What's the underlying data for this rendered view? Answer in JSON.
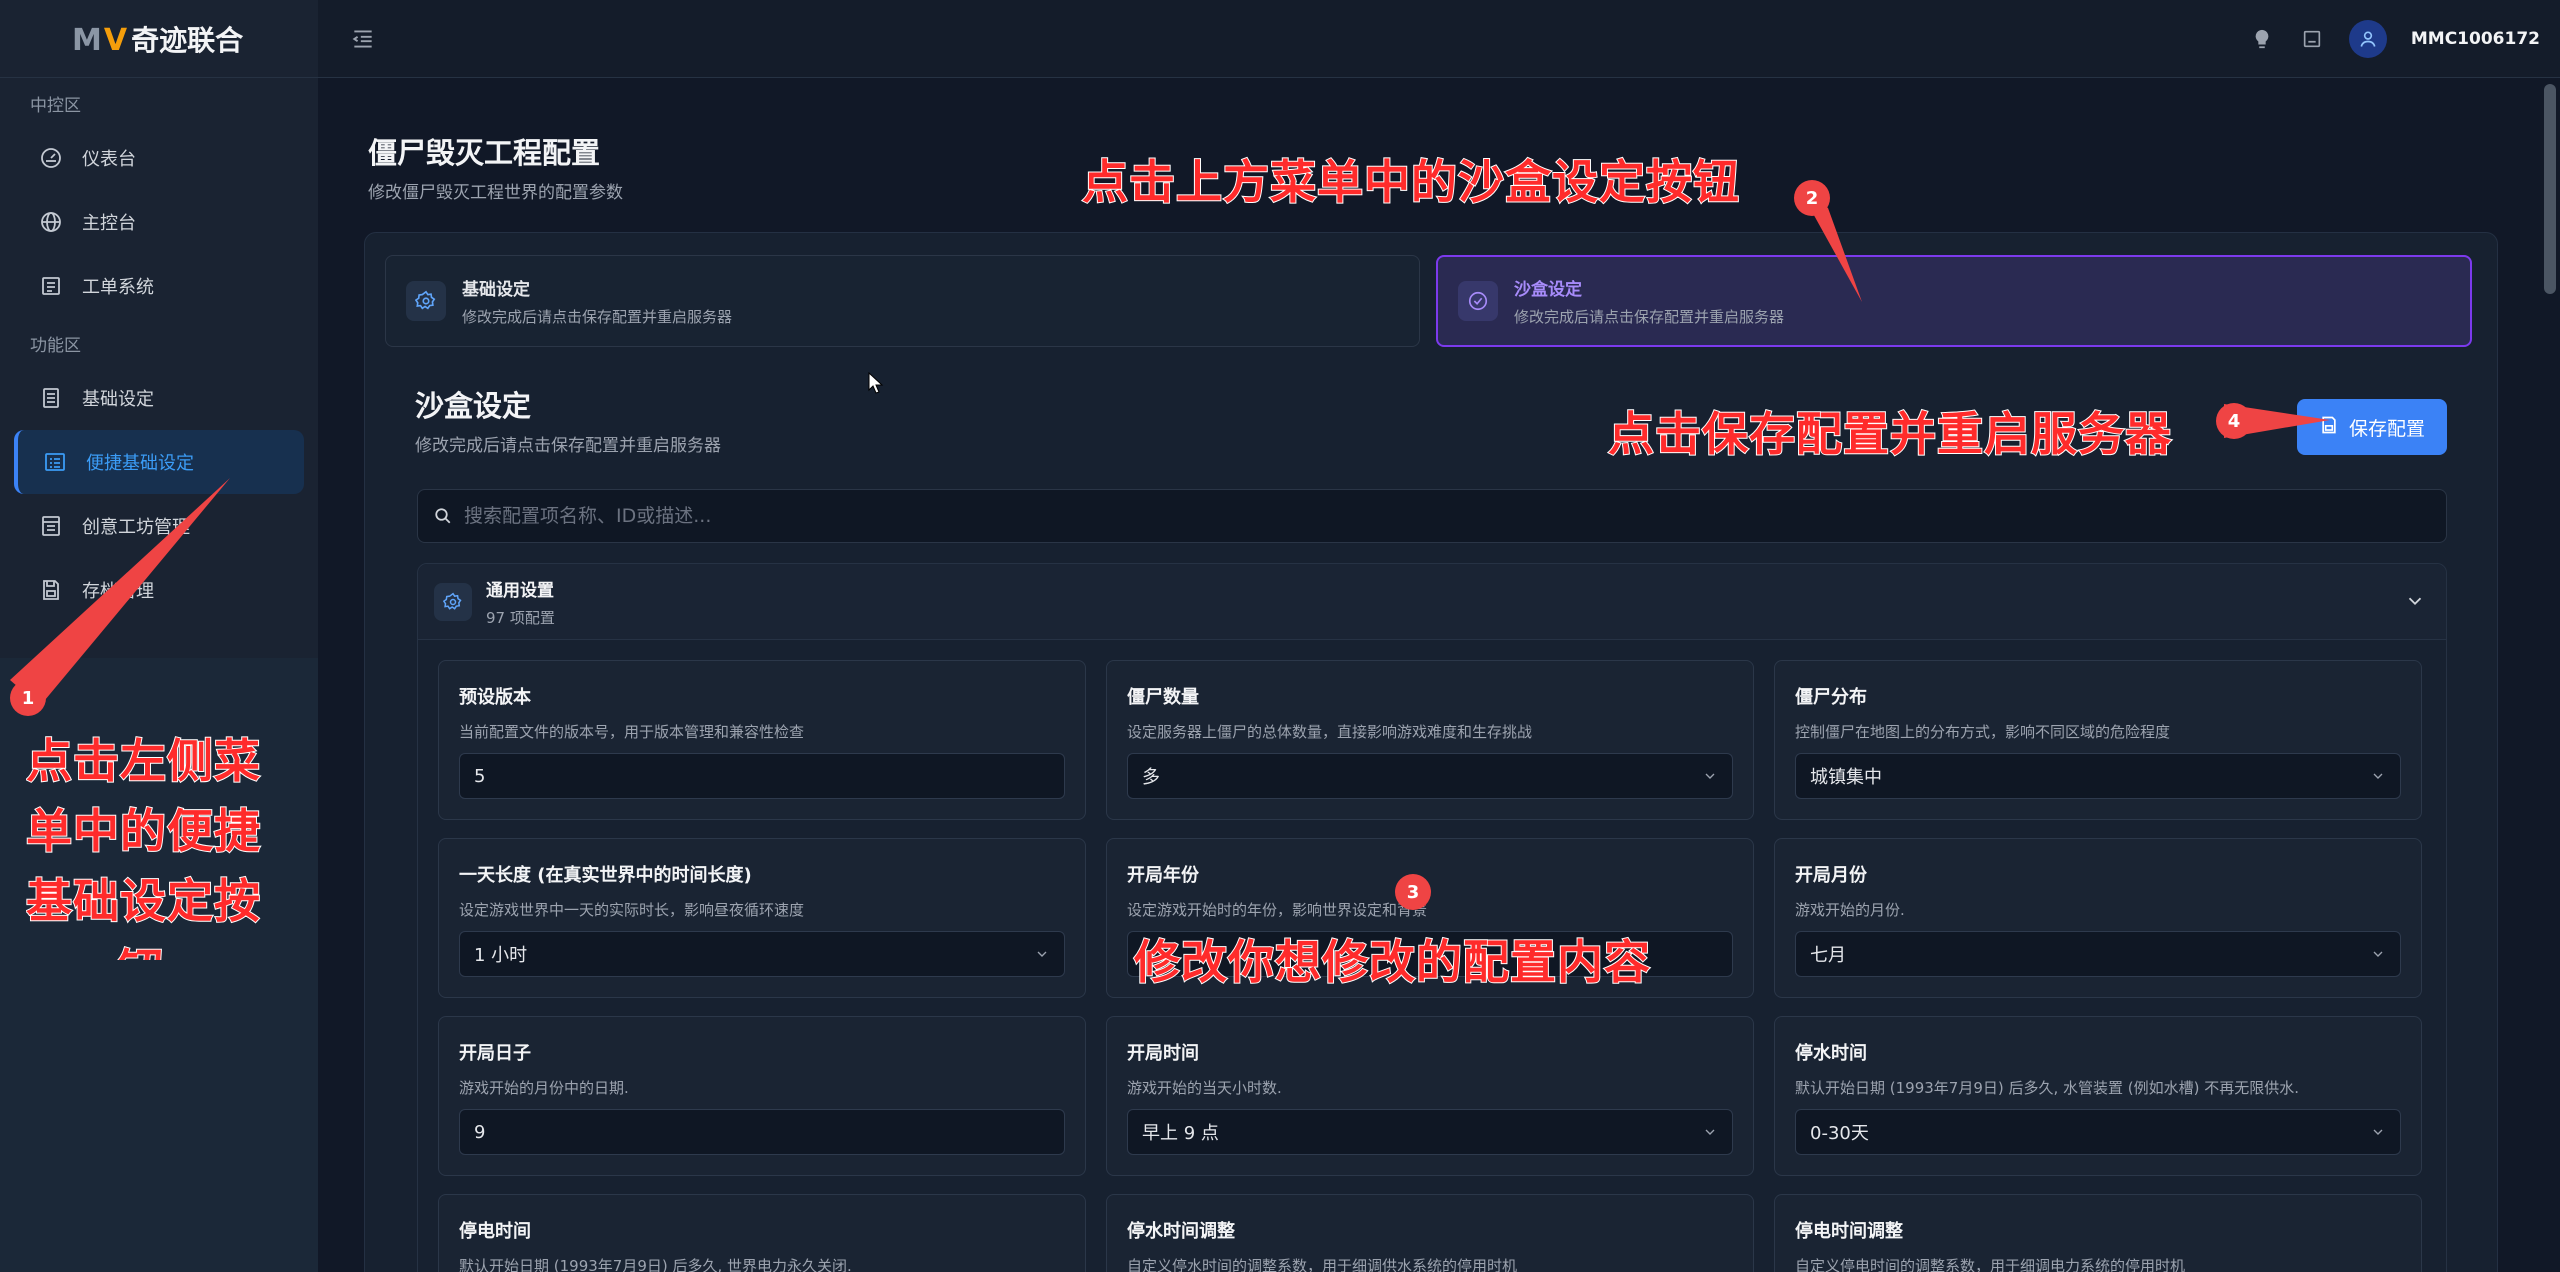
{
  "brand": {
    "logo_m": "M",
    "logo_v": "V",
    "name": "奇迹联合"
  },
  "sidebar": {
    "section1": "中控区",
    "items1": [
      {
        "label": "仪表台",
        "icon": "dashboard-icon"
      },
      {
        "label": "主控台",
        "icon": "globe-icon"
      },
      {
        "label": "工单系统",
        "icon": "ticket-list-icon"
      }
    ],
    "section2": "功能区",
    "items2": [
      {
        "label": "基础设定",
        "icon": "document-icon"
      },
      {
        "label": "便捷基础设定",
        "icon": "list-settings-icon",
        "active": true
      },
      {
        "label": "创意工坊管理",
        "icon": "workshop-icon"
      },
      {
        "label": "存档管理",
        "icon": "save-icon"
      }
    ]
  },
  "header": {
    "username": "MMC1006172"
  },
  "page": {
    "title": "僵尸毁灭工程配置",
    "subtitle": "修改僵尸毁灭工程世界的配置参数"
  },
  "tabs": [
    {
      "title": "基础设定",
      "desc": "修改完成后请点击保存配置并重启服务器"
    },
    {
      "title": "沙盒设定",
      "desc": "修改完成后请点击保存配置并重启服务器",
      "active": true
    }
  ],
  "section": {
    "title": "沙盒设定",
    "subtitle": "修改完成后请点击保存配置并重启服务器",
    "save_label": "保存配置"
  },
  "search": {
    "placeholder": "搜索配置项名称、ID或描述..."
  },
  "group": {
    "title": "通用设置",
    "count": "97 项配置"
  },
  "configs": [
    {
      "title": "预设版本",
      "desc": "当前配置文件的版本号，用于版本管理和兼容性检查",
      "value": "5",
      "type": "input"
    },
    {
      "title": "僵尸数量",
      "desc": "设定服务器上僵尸的总体数量，直接影响游戏难度和生存挑战",
      "value": "多",
      "type": "select"
    },
    {
      "title": "僵尸分布",
      "desc": "控制僵尸在地图上的分布方式，影响不同区域的危险程度",
      "value": "城镇集中",
      "type": "select"
    },
    {
      "title": "一天长度 (在真实世界中的时间长度)",
      "desc": "设定游戏世界中一天的实际时长，影响昼夜循环速度",
      "value": "1 小时",
      "type": "select"
    },
    {
      "title": "开局年份",
      "desc": "设定游戏开始时的年份，影响世界设定和背景",
      "value": "",
      "type": "input"
    },
    {
      "title": "开局月份",
      "desc": "游戏开始的月份.",
      "value": "七月",
      "type": "select"
    },
    {
      "title": "开局日子",
      "desc": "游戏开始的月份中的日期.",
      "value": "9",
      "type": "input"
    },
    {
      "title": "开局时间",
      "desc": "游戏开始的当天小时数.",
      "value": "早上 9 点",
      "type": "select"
    },
    {
      "title": "停水时间",
      "desc": "默认开始日期 (1993年7月9日) 后多久, 水管装置 (例如水槽) 不再无限供水.",
      "value": "0-30天",
      "type": "select"
    },
    {
      "title": "停电时间",
      "desc": "默认开始日期 (1993年7月9日) 后多久, 世界电力永久关闭.",
      "value": "",
      "type": "cut"
    },
    {
      "title": "停水时间调整",
      "desc": "自定义停水时间的调整系数，用于细调供水系统的停用时机",
      "value": "",
      "type": "cut"
    },
    {
      "title": "停电时间调整",
      "desc": "自定义停电时间的调整系数，用于细调电力系统的停用时机",
      "value": "",
      "type": "cut"
    }
  ],
  "annotations": {
    "a1": "点击左侧菜单中的便捷基础设定按钮",
    "a1_lines": [
      "点击左侧菜",
      "单中的便捷",
      "基础设定按",
      "钮"
    ],
    "a2": "点击上方菜单中的沙盒设定按钮",
    "a3": "修改你想修改的配置内容",
    "a4": "点击保存配置并重启服务器",
    "badge1": "1",
    "badge2": "2",
    "badge3": "3",
    "badge4": "4",
    "color": "#ff2b2b"
  }
}
